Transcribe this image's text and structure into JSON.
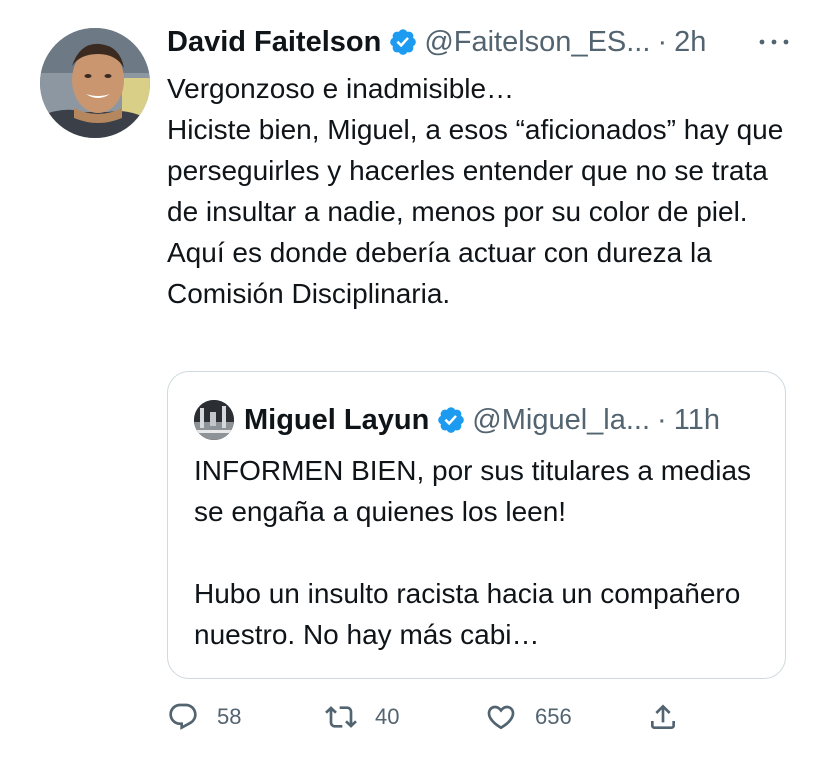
{
  "tweet": {
    "author_name": "David Faitelson",
    "author_handle": "@Faitelson_ES...",
    "separator": "·",
    "time": "2h",
    "more_label": "···",
    "text": "Vergonzoso e inadmisible…\nHiciste bien, Miguel, a esos “aficionados” hay que perseguirles y hacerles entender que no se trata de insultar a nadie, menos por su color de piel.  Aquí es donde debería actuar con dureza la Comisión Disciplinaria."
  },
  "quote": {
    "author_name": "Miguel Layun",
    "author_handle": "@Miguel_la...",
    "separator": "·",
    "time": "11h",
    "text": "INFORMEN BIEN, por sus titulares a medias se engaña a quienes los leen!\n\nHubo un insulto racista hacia un compañero nuestro. No hay más cabi…"
  },
  "actions": {
    "replies": "58",
    "retweets": "40",
    "likes": "656"
  },
  "icons": {
    "avatar": "profile-photo",
    "quote_avatar": "profile-photo",
    "verified": "verified-badge-icon",
    "more": "more-dots-icon",
    "reply": "reply-icon",
    "retweet": "retweet-icon",
    "like": "heart-icon",
    "share": "share-icon"
  },
  "colors": {
    "verified": "#1d9bf0",
    "secondary_text": "#536471",
    "border": "#cfd9de"
  }
}
